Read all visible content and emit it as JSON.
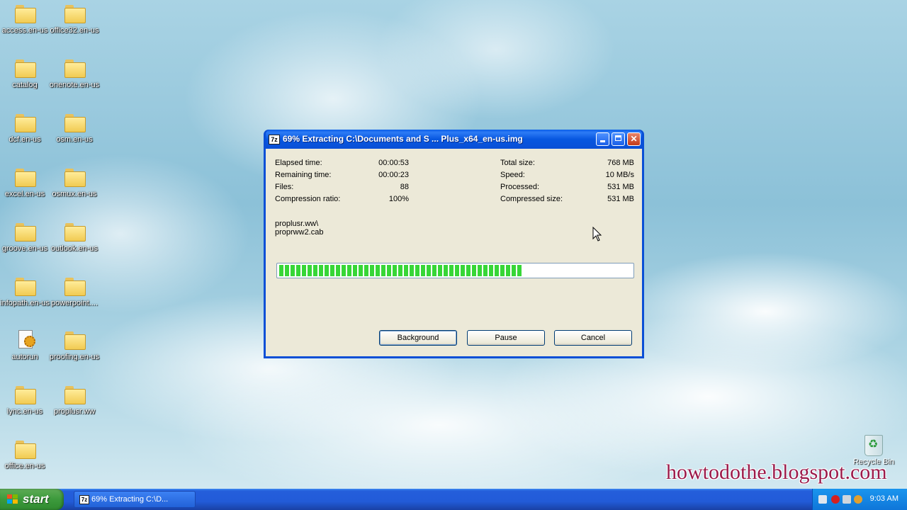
{
  "desktop": {
    "icons": [
      {
        "label": "access.en-us",
        "type": "folder"
      },
      {
        "label": "office32.en-us",
        "type": "folder"
      },
      {
        "label": "catalog",
        "type": "folder"
      },
      {
        "label": "onenote.en-us",
        "type": "folder"
      },
      {
        "label": "dcf.en-us",
        "type": "folder"
      },
      {
        "label": "osm.en-us",
        "type": "folder"
      },
      {
        "label": "excel.en-us",
        "type": "folder"
      },
      {
        "label": "osmux.en-us",
        "type": "folder"
      },
      {
        "label": "groove.en-us",
        "type": "folder"
      },
      {
        "label": "outlook.en-us",
        "type": "folder"
      },
      {
        "label": "infopath.en-us",
        "type": "folder"
      },
      {
        "label": "powerpoint....",
        "type": "folder"
      },
      {
        "label": "autorun",
        "type": "autorun-file"
      },
      {
        "label": "proofing.en-us",
        "type": "folder"
      },
      {
        "label": "lync.en-us",
        "type": "folder"
      },
      {
        "label": "proplusr.ww",
        "type": "folder"
      },
      {
        "label": "office.en-us",
        "type": "folder"
      }
    ],
    "recycle_bin": {
      "label": "Recycle Bin"
    },
    "watermark": "howtodothe.blogspot.com"
  },
  "window": {
    "title": "69% Extracting C:\\Documents and S ... Plus_x64_en-us.img",
    "app_icon": "7z",
    "stats_left": [
      {
        "label": "Elapsed time:",
        "value": "00:00:53"
      },
      {
        "label": "Remaining time:",
        "value": "00:00:23"
      },
      {
        "label": "Files:",
        "value": "88"
      },
      {
        "label": "Compression ratio:",
        "value": "100%"
      }
    ],
    "stats_right": [
      {
        "label": "Total size:",
        "value": "768 MB"
      },
      {
        "label": "Speed:",
        "value": "10 MB/s"
      },
      {
        "label": "Processed:",
        "value": "531 MB"
      },
      {
        "label": "Compressed size:",
        "value": "531 MB"
      }
    ],
    "current_folder": "proplusr.ww\\",
    "current_file": "proprww2.cab",
    "progress_fraction": 0.69,
    "buttons": {
      "background": "Background",
      "pause": "Pause",
      "cancel": "Cancel"
    }
  },
  "taskbar": {
    "start_label": "start",
    "task_label": "69% Extracting C:\\D...",
    "clock": "9:03 AM"
  },
  "colors": {
    "progress": "#37d637",
    "titlebar": "#0a4fd6",
    "watermark": "#9b1a4a",
    "start": "#3c9a3c"
  }
}
